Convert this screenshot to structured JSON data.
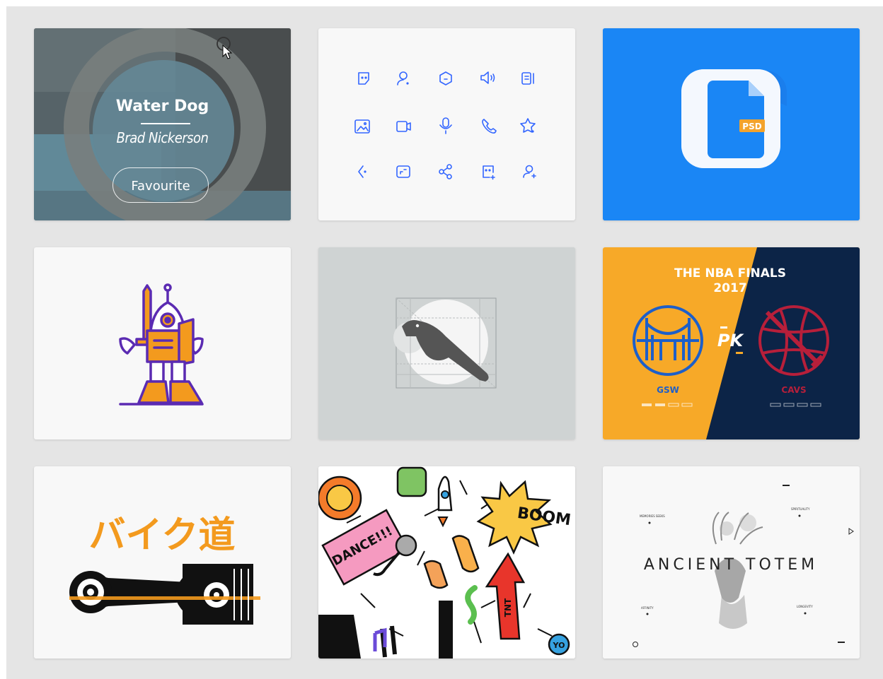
{
  "cards": [
    {
      "title": "Water Dog",
      "author": "Brad Nickerson",
      "button_label": "Favourite"
    },
    {
      "icons": [
        "sticker-icon",
        "user-icon",
        "hexagon-icon",
        "speaker-icon",
        "document-icon",
        "image-icon",
        "video-icon",
        "microphone-icon",
        "phone-icon",
        "star-icon",
        "back-icon",
        "resize-icon",
        "share-icon",
        "emoji-add-icon",
        "add-user-icon"
      ],
      "accent": "#3366ff"
    },
    {
      "badge": "PSD",
      "bg": "#1a86f5"
    },
    {
      "subject": "robot-knight-icon",
      "colors": [
        "#5b2bb2",
        "#f39a1e"
      ]
    },
    {
      "subject": "bird-logo-grid"
    },
    {
      "heading_line1": "THE NBA FINALS",
      "heading_line2": "2017",
      "vs": "PK",
      "team_left": "GSW",
      "team_right": "CAVS",
      "left_color": "#f7a928",
      "right_color": "#0c2447"
    },
    {
      "japanese": "バイク道",
      "color": "#f39a1e"
    },
    {
      "words": [
        "DANCE!!!",
        "BOOM",
        "TNT",
        "YO"
      ]
    },
    {
      "title": "ANCIENT TOTEM",
      "labels": [
        "MEMORIES SEEKS",
        "SPIRITUALITY",
        "AFFINITY",
        "LONGEVITY"
      ]
    }
  ]
}
